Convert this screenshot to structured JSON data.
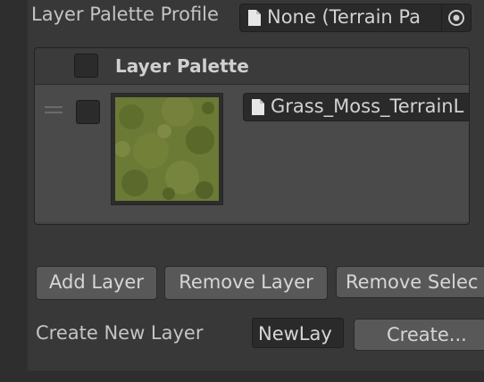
{
  "profile": {
    "label": "Layer Palette Profile",
    "field_value": "None (Terrain Pa",
    "icons": {
      "file": "file-icon",
      "picker": "object-picker-icon"
    }
  },
  "palette": {
    "title": "Layer Palette",
    "layers": [
      {
        "layer_name": "Grass_Moss_TerrainL",
        "thumbnail": "grass-moss-texture",
        "selected": false
      }
    ]
  },
  "buttons": {
    "add_layer": "Add Layer",
    "remove_layer": "Remove Layer",
    "remove_selected": "Remove Selec"
  },
  "create": {
    "label": "Create New Layer",
    "name_value": "NewLay",
    "button": "Create..."
  },
  "colors": {
    "background": "#383838",
    "field": "#2a2a2a",
    "button": "#585858",
    "grass": "#6b7a35"
  }
}
